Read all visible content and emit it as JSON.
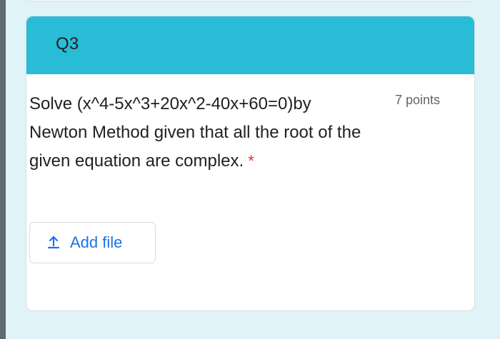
{
  "colors": {
    "accent": "#29bcd7",
    "required": "#d93025",
    "link": "#1a73e8"
  },
  "question": {
    "header_title": "Q3",
    "text": "Solve (x^4-5x^3+20x^2-40x+60=0)by Newton Method given that all the root of the given equation are complex.",
    "required_marker": "*",
    "points": "7 points"
  },
  "upload": {
    "label": "Add file",
    "icon": "upload-icon"
  }
}
